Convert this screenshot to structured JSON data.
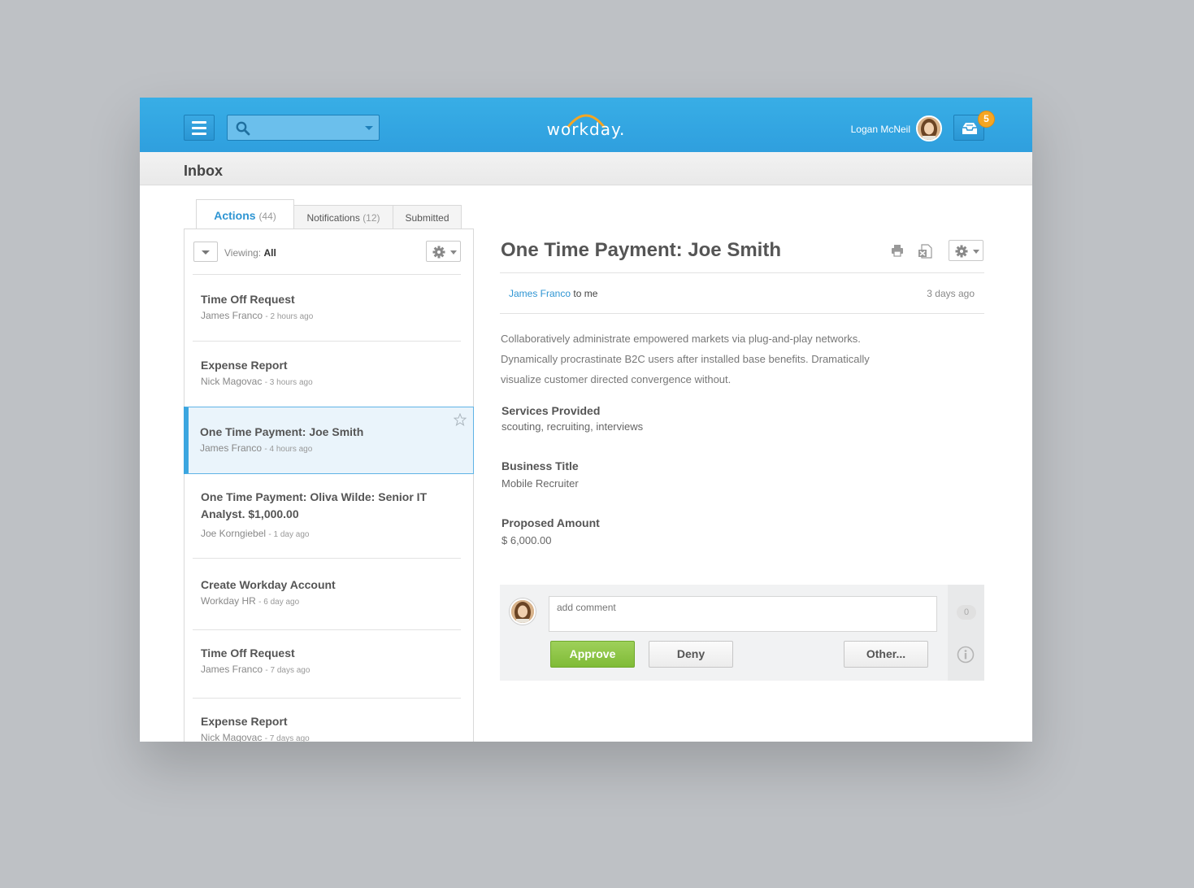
{
  "header": {
    "logo_text": "workday.",
    "user_name": "Logan McNeil",
    "inbox_badge": "5",
    "search_placeholder": ""
  },
  "page": {
    "title": "Inbox"
  },
  "tabs": [
    {
      "label": "Actions",
      "count": "(44)",
      "active": true
    },
    {
      "label": "Notifications",
      "count": "(12)",
      "active": false
    },
    {
      "label": "Submitted",
      "count": "",
      "active": false
    }
  ],
  "list_toolbar": {
    "viewing_label": "Viewing:",
    "viewing_value": "All"
  },
  "list": [
    {
      "title": "Time Off Request",
      "author": "James Franco",
      "time": "- 2 hours ago"
    },
    {
      "title": "Expense Report",
      "author": "Nick Magovac",
      "time": "- 3 hours ago"
    },
    {
      "title": "One Time Payment: Joe Smith",
      "author": "James Franco",
      "time": "- 4 hours ago",
      "selected": true
    },
    {
      "title": "One Time Payment: Oliva Wilde: Senior IT Analyst. $1,000.00",
      "author": "Joe Korngiebel",
      "time": "- 1 day ago"
    },
    {
      "title": "Create Workday Account",
      "author": "Workday HR",
      "time": "- 6 day ago"
    },
    {
      "title": "Time Off Request",
      "author": "James Franco",
      "time": "- 7 days ago"
    },
    {
      "title": "Expense Report",
      "author": "Nick Magovac",
      "time": "- 7 days ago"
    }
  ],
  "detail": {
    "title": "One Time Payment: Joe Smith",
    "sender": "James Franco",
    "recipient": "to me",
    "ago": "3 days ago",
    "body_lines": [
      "Collaboratively administrate empowered markets via plug-and-play networks.",
      "Dynamically procrastinate B2C users after installed base benefits. Dramatically",
      "visualize customer directed convergence without."
    ],
    "fields": [
      {
        "label": "Services Provided",
        "value": "scouting, recruiting, interviews"
      },
      {
        "label": "Business Title",
        "value": "Mobile Recruiter"
      },
      {
        "label": "Proposed Amount",
        "value": "$ 6,000.00"
      }
    ]
  },
  "comment": {
    "placeholder": "add comment",
    "count": "0",
    "approve_label": "Approve",
    "deny_label": "Deny",
    "other_label": "Other..."
  },
  "colors": {
    "header_blue": "#33a8e3",
    "accent_blue": "#2e95d3",
    "approve_green": "#8cc544",
    "badge_orange": "#f5a623"
  }
}
